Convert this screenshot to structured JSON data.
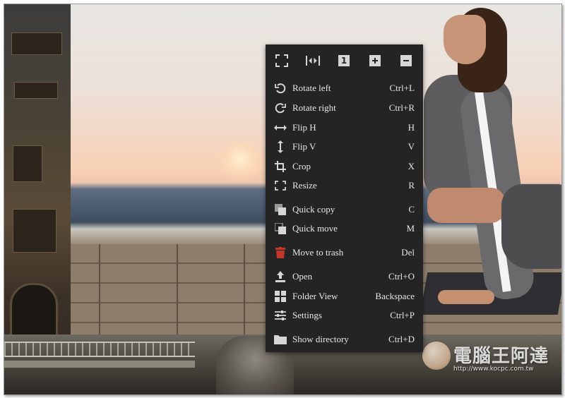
{
  "toolbar": [
    {
      "name": "fullscreen",
      "icon": "fullscreen-icon"
    },
    {
      "name": "fit-width",
      "icon": "fit-width-icon"
    },
    {
      "name": "actual-size",
      "icon": "actual-size-icon",
      "text": "1"
    },
    {
      "name": "zoom-in",
      "icon": "zoom-in-icon"
    },
    {
      "name": "zoom-out",
      "icon": "zoom-out-icon"
    }
  ],
  "menu": {
    "items": [
      {
        "label": "Rotate left",
        "shortcut": "Ctrl+L",
        "icon": "rotate-left-icon"
      },
      {
        "label": "Rotate right",
        "shortcut": "Ctrl+R",
        "icon": "rotate-right-icon"
      },
      {
        "label": "Flip H",
        "shortcut": "H",
        "icon": "flip-horizontal-icon"
      },
      {
        "label": "Flip V",
        "shortcut": "V",
        "icon": "flip-vertical-icon"
      },
      {
        "label": "Crop",
        "shortcut": "X",
        "icon": "crop-icon"
      },
      {
        "label": "Resize",
        "shortcut": "R",
        "icon": "resize-icon"
      },
      {
        "label": "Quick copy",
        "shortcut": "C",
        "icon": "quick-copy-icon"
      },
      {
        "label": "Quick move",
        "shortcut": "M",
        "icon": "quick-move-icon"
      },
      {
        "label": "Move to trash",
        "shortcut": "Del",
        "icon": "trash-icon"
      },
      {
        "label": "Open",
        "shortcut": "Ctrl+O",
        "icon": "open-icon"
      },
      {
        "label": "Folder View",
        "shortcut": "Backspace",
        "icon": "folder-view-icon"
      },
      {
        "label": "Settings",
        "shortcut": "Ctrl+P",
        "icon": "settings-icon"
      },
      {
        "label": "Show directory",
        "shortcut": "Ctrl+D",
        "icon": "folder-icon"
      }
    ]
  },
  "watermark": {
    "title": "電腦王阿達",
    "url": "http://www.kocpc.com.tw"
  },
  "colors": {
    "menu_bg": "#242424",
    "menu_text": "#e6e6e6",
    "icon": "#d6d6d6",
    "trash_red": "#c0392b"
  }
}
